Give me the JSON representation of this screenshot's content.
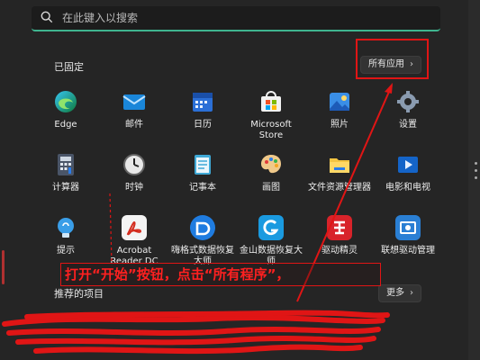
{
  "search": {
    "placeholder": "在此键入以搜索"
  },
  "pinned": {
    "title": "已固定",
    "all_apps_label": "所有应用",
    "apps": [
      {
        "label": "Edge",
        "icon": "edge-icon"
      },
      {
        "label": "邮件",
        "icon": "mail-icon"
      },
      {
        "label": "日历",
        "icon": "calendar-icon"
      },
      {
        "label": "Microsoft Store",
        "icon": "store-icon"
      },
      {
        "label": "照片",
        "icon": "photos-icon"
      },
      {
        "label": "设置",
        "icon": "gear-icon"
      },
      {
        "label": "计算器",
        "icon": "calculator-icon"
      },
      {
        "label": "时钟",
        "icon": "clock-icon"
      },
      {
        "label": "记事本",
        "icon": "notepad-icon"
      },
      {
        "label": "画图",
        "icon": "paint-icon"
      },
      {
        "label": "文件资源管理器",
        "icon": "folder-icon"
      },
      {
        "label": "电影和电视",
        "icon": "movies-icon"
      },
      {
        "label": "提示",
        "icon": "tips-icon"
      },
      {
        "label": "Acrobat Reader DC",
        "icon": "acrobat-icon"
      },
      {
        "label": "嗨格式数据恢复大师",
        "icon": "recovery-icon"
      },
      {
        "label": "金山数据恢复大师",
        "icon": "kingsoft-icon"
      },
      {
        "label": "驱动精灵",
        "icon": "driver-icon"
      },
      {
        "label": "联想驱动管理",
        "icon": "lenovo-icon"
      }
    ]
  },
  "recommended": {
    "title": "推荐的项目",
    "more_label": "更多"
  },
  "annotation": {
    "text": "打开“开始”按钮，点击“所有程序”，"
  },
  "colors": {
    "accent": "#3fb58f",
    "annotation": "#e01515",
    "panel": "#252525"
  }
}
